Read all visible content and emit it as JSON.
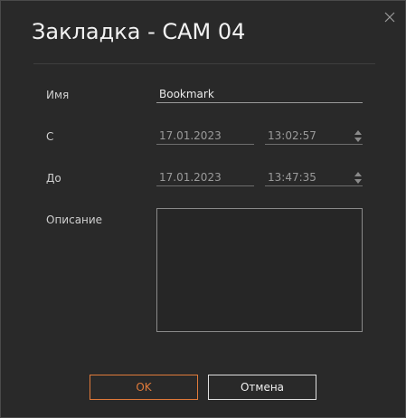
{
  "dialog": {
    "title": "Закладка - CAM 04",
    "close_icon": "close-icon"
  },
  "form": {
    "name_label": "Имя",
    "name_value": "Bookmark",
    "from_label": "С",
    "from_date": "17.01.2023",
    "from_time": "13:02:57",
    "to_label": "До",
    "to_date": "17.01.2023",
    "to_time": "13:47:35",
    "description_label": "Описание",
    "description_value": ""
  },
  "buttons": {
    "ok_label": "OK",
    "cancel_label": "Отмена"
  },
  "colors": {
    "accent": "#e07a3a",
    "background": "#292929"
  }
}
